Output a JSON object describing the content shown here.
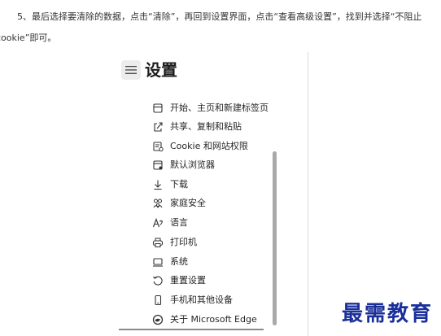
{
  "instruction": {
    "line1": "5、最后选择要清除的数据，点击“清除”，再回到设置界面，点击“查看高级设置”，找到并选择“不阻止",
    "line2": "cookie”即可。"
  },
  "settings": {
    "title": "设置",
    "menu_icon": "hamburger-menu-icon",
    "items": [
      {
        "label": "开始、主页和新建标签页",
        "icon": "home-page-icon"
      },
      {
        "label": "共享、复制和粘贴",
        "icon": "share-icon"
      },
      {
        "label": "Cookie 和网站权限",
        "icon": "cookie-permissions-icon"
      },
      {
        "label": "默认浏览器",
        "icon": "default-browser-icon"
      },
      {
        "label": "下载",
        "icon": "download-icon"
      },
      {
        "label": "家庭安全",
        "icon": "family-icon"
      },
      {
        "label": "语言",
        "icon": "language-icon"
      },
      {
        "label": "打印机",
        "icon": "printer-icon"
      },
      {
        "label": "系统",
        "icon": "system-icon"
      },
      {
        "label": "重置设置",
        "icon": "reset-icon"
      },
      {
        "label": "手机和其他设备",
        "icon": "phone-icon"
      },
      {
        "label": "关于 Microsoft Edge",
        "icon": "edge-logo-icon"
      }
    ]
  },
  "watermark": "最需教育"
}
